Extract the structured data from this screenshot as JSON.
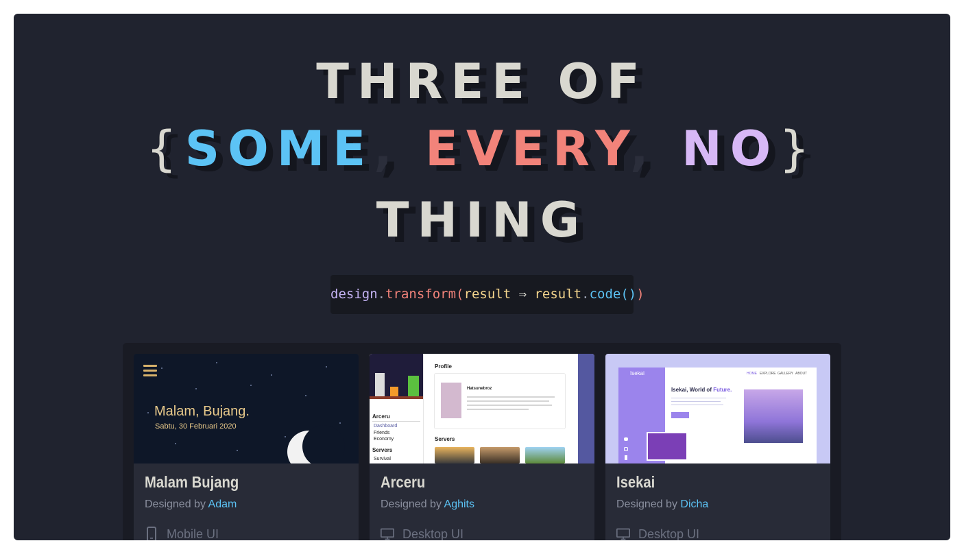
{
  "hero": {
    "line1": "THREE OF",
    "brace_open": "{",
    "word_some": "SOME",
    "comma1": ",",
    "word_every": "EVERY",
    "comma2": ",",
    "word_no": "NO",
    "brace_close": "}",
    "line3": "THING"
  },
  "code": {
    "obj": "design",
    "dot1": ".",
    "fn": "transform",
    "paren_open": "(",
    "arg": "result",
    "arrow": " ⇒ ",
    "arg2": "result",
    "dot2": ".",
    "method": "code",
    "call": "()",
    "paren_close": ")"
  },
  "colors": {
    "background": "#20232f",
    "some": "#5cc3f5",
    "every": "#f2837a",
    "no": "#d7b8f6",
    "link": "#5cc3f5"
  },
  "cards": [
    {
      "title": "Malam Bujang",
      "by_prefix": "Designed by ",
      "author": "Adam",
      "type": "Mobile UI",
      "type_icon": "mobile-icon",
      "thumb": {
        "greeting": "Malam, Bujang.",
        "date": "Sabtu, 30 Februari 2020"
      }
    },
    {
      "title": "Arceru",
      "by_prefix": "Designed by ",
      "author": "Aghits",
      "type": "Desktop UI",
      "type_icon": "desktop-icon",
      "thumb": {
        "profile": "Profile",
        "name": "Hatsunebroz",
        "servers": "Servers",
        "section": "Arceru",
        "nav1": "Dashboard",
        "nav2": "Friends",
        "nav3": "Economy",
        "servers2": "Servers",
        "nav4": "Survival"
      }
    },
    {
      "title": "Isekai",
      "by_prefix": "Designed by ",
      "author": "Dicha",
      "type": "Desktop UI",
      "type_icon": "desktop-icon",
      "thumb": {
        "logo": "Isekai",
        "headline": "Isekai, World of ",
        "headline_accent": "Future.",
        "nav1": "HOME",
        "nav2": "EXPLORE",
        "nav3": "GALLERY",
        "nav4": "ABOUT"
      }
    }
  ]
}
